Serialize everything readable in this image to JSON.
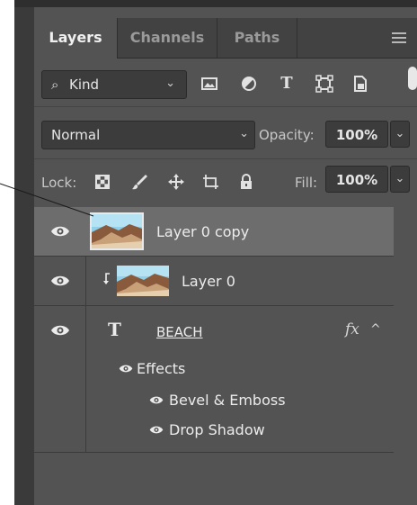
{
  "tabs": [
    {
      "label": "Layers",
      "active": true
    },
    {
      "label": "Channels",
      "active": false
    },
    {
      "label": "Paths",
      "active": false
    }
  ],
  "filter": {
    "kind_label": "Kind",
    "icons": [
      "image-filter-icon",
      "adjustment-filter-icon",
      "type-filter-icon",
      "shape-filter-icon",
      "smart-object-filter-icon"
    ],
    "type_icon_glyph": "T"
  },
  "blend": {
    "mode": "Normal",
    "opacity_label": "Opacity:",
    "opacity_value": "100%"
  },
  "lock": {
    "label": "Lock:",
    "fill_label": "Fill:",
    "fill_value": "100%"
  },
  "layers": [
    {
      "name": "Layer 0 copy",
      "visible": true,
      "selected": true
    },
    {
      "name": "Layer 0",
      "visible": true,
      "selected": false,
      "clipped": true
    },
    {
      "name": "BEACH",
      "visible": true,
      "selected": false,
      "type": "text",
      "fx": "fx",
      "type_glyph": "T"
    }
  ],
  "effects": {
    "label": "Effects",
    "items": [
      "Bevel & Emboss",
      "Drop Shadow"
    ]
  },
  "colors": {
    "panel_bg": "#535353",
    "selected_row": "#6d6d6d",
    "text": "#ececec"
  }
}
